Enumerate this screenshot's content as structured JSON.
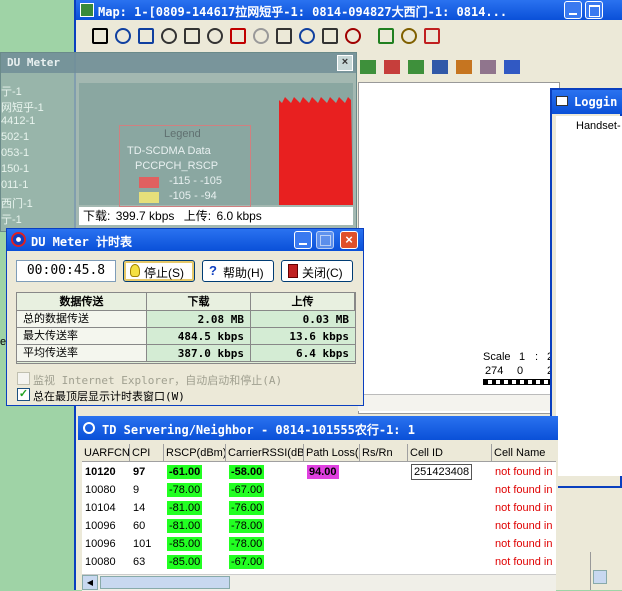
{
  "left_labels": [
    "亍-1",
    "网短乎-1",
    "4412-1",
    "502-1",
    "053-1",
    "150-1",
    "011-1",
    "西门-1",
    "亍-1"
  ],
  "left_extra": "el",
  "map_window": {
    "title": "Map: 1-[0809-144617拉网短乎-1: 0814-094827大西门-1: 0814...",
    "legend_title": "Legend",
    "legend_layer": "TD-SCDMA Data",
    "legend_param": "PCCPCH_RSCP",
    "legend_items": [
      {
        "range": "-115 - -105",
        "color": "#e06060"
      },
      {
        "range": "-105 - -94",
        "color": "#e6e07a"
      }
    ],
    "scale_label": "Scale",
    "scale_values": [
      "1",
      ":",
      "2"
    ],
    "scale_ticks": [
      "274",
      "0",
      "2"
    ]
  },
  "du_meter_graph": {
    "title": "DU Meter",
    "download_label": "下载:",
    "download_value": "399.7 kbps",
    "upload_label": "上传:",
    "upload_value": "6.0 kbps"
  },
  "timer_dialog": {
    "title": "DU Meter 计时表",
    "elapsed": "00:00:45.8",
    "stop_label": "停止(S)",
    "help_label": "帮助(H)",
    "close_label": "关闭(C)",
    "table_headers": [
      "数据传送",
      "下载",
      "上传"
    ],
    "rows": [
      {
        "label": "总的数据传送",
        "down": "2.08 MB",
        "up": "0.03 MB"
      },
      {
        "label": "最大传送率",
        "down": "484.5 kbps",
        "up": "13.6 kbps"
      },
      {
        "label": "平均传送率",
        "down": "387.0 kbps",
        "up": "6.4 kbps"
      }
    ],
    "checkbox_monitor": "监视 Internet Explorer，自动启动和停止(A)",
    "checkbox_monitor_checked": false,
    "checkbox_topmost": "总在最顶层显示计时表窗口(W)",
    "checkbox_topmost_checked": true
  },
  "logging_window": {
    "title": "Loggin",
    "item": "Handset-"
  },
  "neighbor_window": {
    "title": "TD Servering/Neighbor - 0814-101555农行-1: 1",
    "columns": [
      "UARFCN",
      "CPI",
      "RSCP(dBm)",
      "CarrierRSSI(dBm)",
      "Path Loss(",
      "Rs/Rn",
      "Cell ID",
      "Cell Name"
    ],
    "rows": [
      {
        "uarfcn": "10120",
        "cpi": "97",
        "rscp": "-61.00",
        "rssi": "-58.00",
        "pathloss": "94.00",
        "rsrn": "",
        "cellid": "251423408",
        "cellname": "not found in",
        "bold": true
      },
      {
        "uarfcn": "10080",
        "cpi": "9",
        "rscp": "-78.00",
        "rssi": "-67.00",
        "pathloss": "",
        "rsrn": "",
        "cellid": "",
        "cellname": "not found in",
        "bold": false
      },
      {
        "uarfcn": "10104",
        "cpi": "14",
        "rscp": "-81.00",
        "rssi": "-76.00",
        "pathloss": "",
        "rsrn": "",
        "cellid": "",
        "cellname": "not found in DB",
        "bold": false
      },
      {
        "uarfcn": "10096",
        "cpi": "60",
        "rscp": "-81.00",
        "rssi": "-78.00",
        "pathloss": "",
        "rsrn": "",
        "cellid": "",
        "cellname": "not found in DB",
        "bold": false
      },
      {
        "uarfcn": "10096",
        "cpi": "101",
        "rscp": "-85.00",
        "rssi": "-78.00",
        "pathloss": "",
        "rsrn": "",
        "cellid": "",
        "cellname": "not found in DB",
        "bold": false
      },
      {
        "uarfcn": "10080",
        "cpi": "63",
        "rscp": "-85.00",
        "rssi": "-67.00",
        "pathloss": "",
        "rsrn": "",
        "cellid": "",
        "cellname": "not found in DB",
        "bold": false
      }
    ]
  },
  "colors": {
    "xp_title": "#0a58e0",
    "rscp_green": "#22ff22",
    "pathloss_magenta": "#e040e0",
    "cellname_red": "#e00000",
    "graph_red": "#e82020"
  }
}
